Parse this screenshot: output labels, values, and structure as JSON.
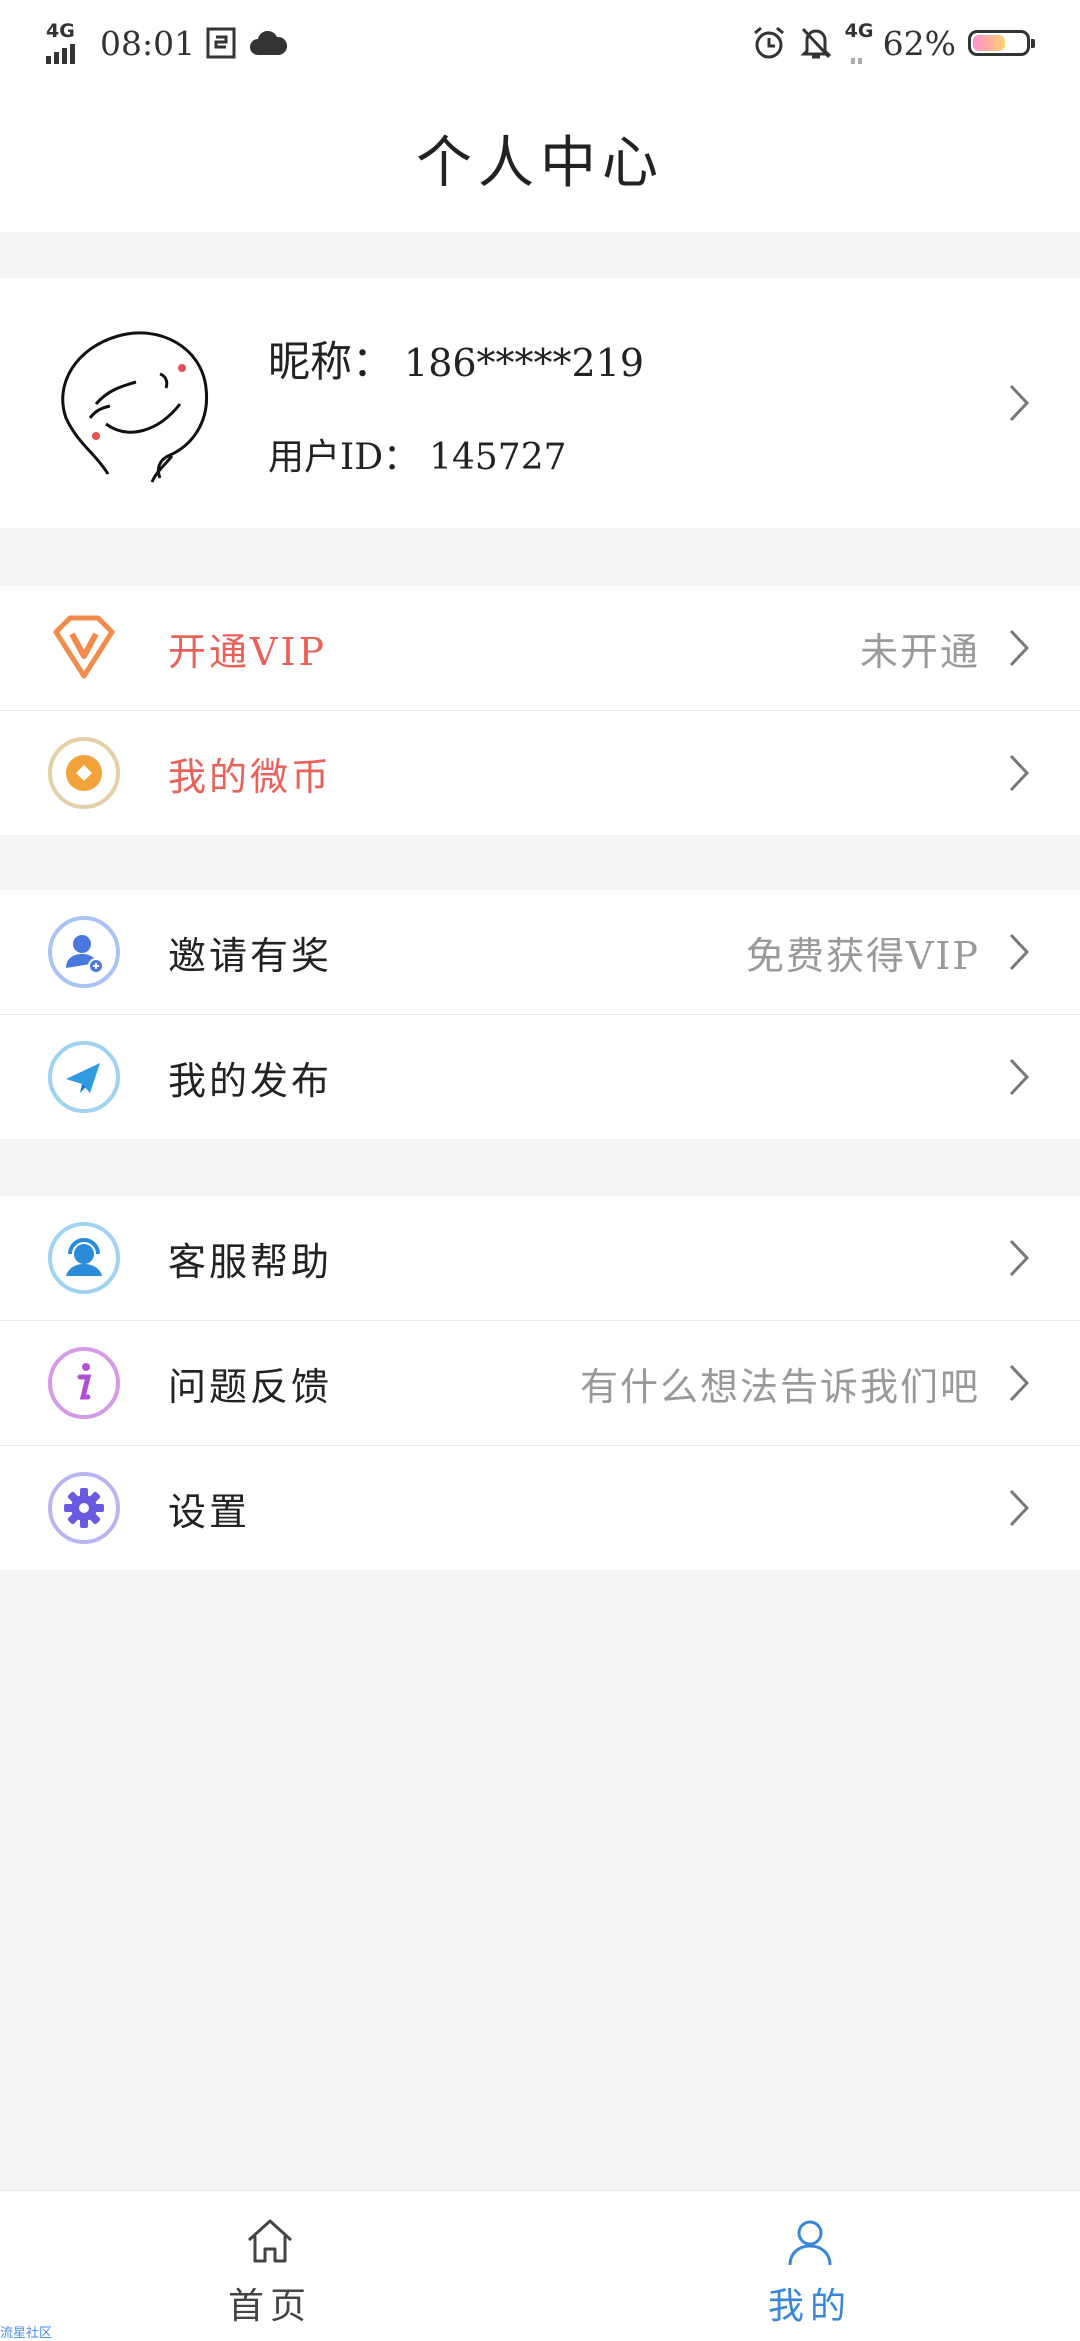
{
  "status_bar": {
    "network": "4G",
    "time": "08:01",
    "battery_percent": "62%",
    "battery_level": 0.62,
    "icons": [
      "signal-icon",
      "sim-icon",
      "cloud-icon",
      "alarm-icon",
      "mute-bell-icon",
      "battery-icon"
    ]
  },
  "header": {
    "title": "个人中心"
  },
  "profile": {
    "nickname_label": "昵称：",
    "nickname_value": "186*****219",
    "user_id_label": "用户ID：",
    "user_id_value": "145727"
  },
  "menu_groups": [
    [
      {
        "label": "开通VIP",
        "value": "未开通",
        "icon": "vip-diamond-icon",
        "label_color": "#e8625a"
      },
      {
        "label": "我的微币",
        "value": "",
        "icon": "coin-icon",
        "label_color": "#e8625a"
      }
    ],
    [
      {
        "label": "邀请有奖",
        "value": "免费获得VIP",
        "icon": "invite-user-icon"
      },
      {
        "label": "我的发布",
        "value": "",
        "icon": "paper-plane-icon"
      }
    ],
    [
      {
        "label": "客服帮助",
        "value": "",
        "icon": "customer-service-icon"
      },
      {
        "label": "问题反馈",
        "value": "有什么想法告诉我们吧",
        "icon": "info-icon"
      },
      {
        "label": "设置",
        "value": "",
        "icon": "settings-gear-icon"
      }
    ]
  ],
  "tab_bar": {
    "tabs": [
      {
        "label": "首页",
        "icon": "home-icon",
        "active": false
      },
      {
        "label": "我的",
        "icon": "person-icon",
        "active": true
      }
    ]
  },
  "watermark": "流星社区",
  "colors": {
    "accent": "#3a86d6",
    "vip_red": "#e8625a",
    "muted": "#999999"
  }
}
